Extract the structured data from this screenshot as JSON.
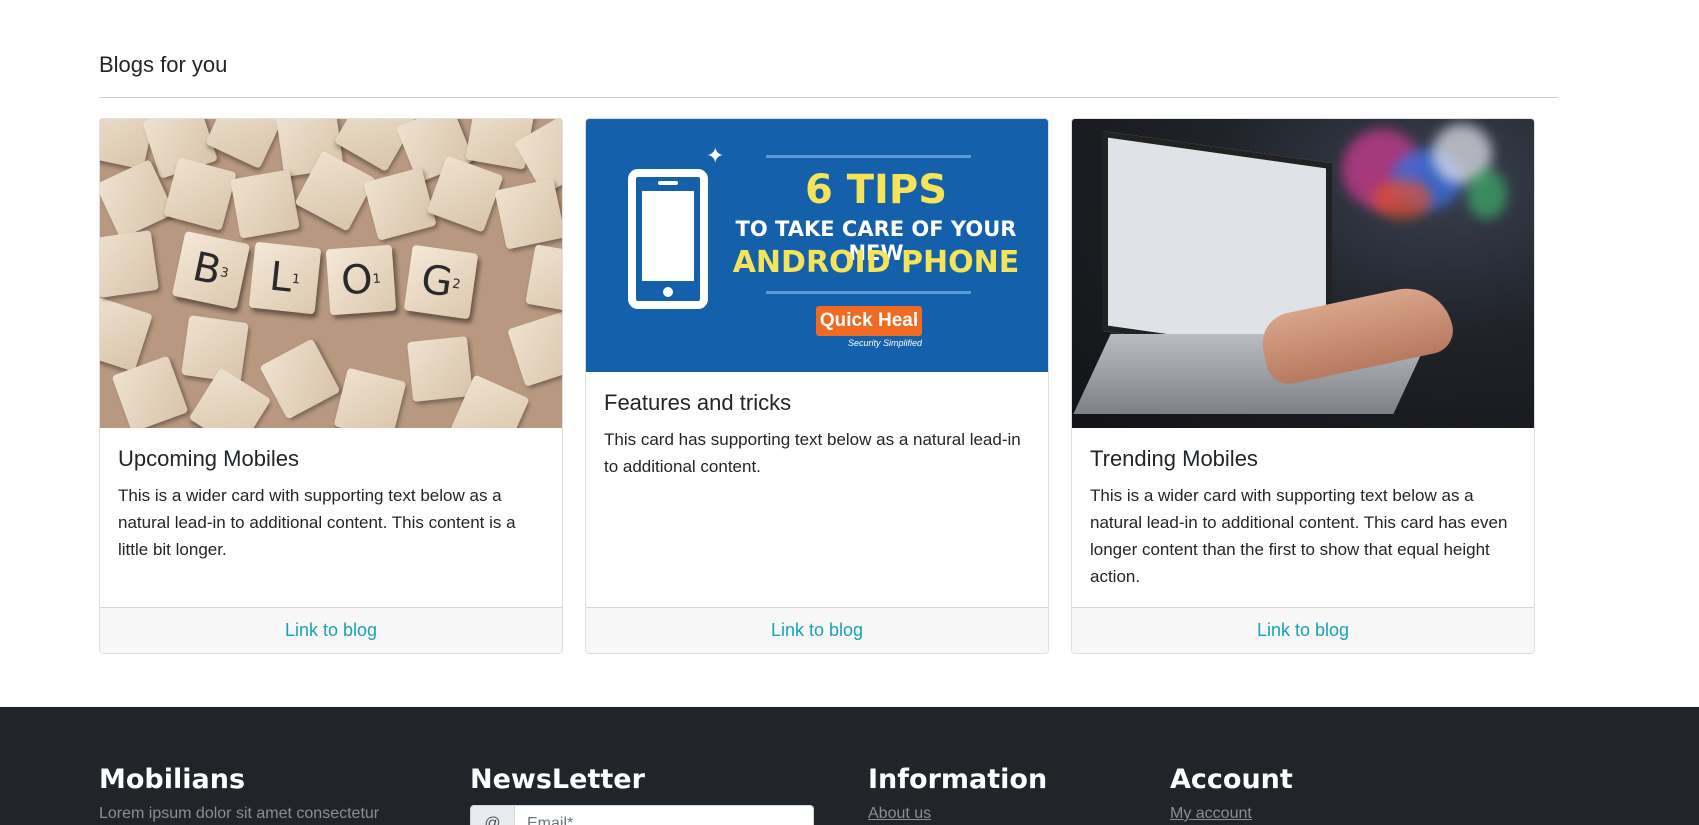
{
  "section": {
    "title": "Blogs for you"
  },
  "cards": [
    {
      "title": "Upcoming Mobiles",
      "text": "This is a wider card with supporting text below as a natural lead-in to additional content. This content is a little bit longer.",
      "link": "Link to blog",
      "image": {
        "tiles": [
          "B",
          "L",
          "O",
          "G"
        ],
        "subscripts": [
          "3",
          "1",
          "1",
          "2"
        ]
      }
    },
    {
      "title": "Features and tricks",
      "text": "This card has supporting text below as a natural lead-in to additional content.",
      "link": "Link to blog",
      "image": {
        "headline": "6 TIPS",
        "line1": "TO TAKE CARE OF YOUR NEW",
        "line2": "ANDROID PHONE",
        "brand": "Quick Heal",
        "tagline": "Security Simplified",
        "icon": "smartphone-icon"
      }
    },
    {
      "title": "Trending Mobiles",
      "text": "This is a wider card with supporting text below as a natural lead-in to additional content. This card has even longer content than the first to show that equal height action.",
      "link": "Link to blog"
    }
  ],
  "footer": {
    "brand": {
      "title": "Mobilians",
      "text": "Lorem ipsum dolor sit amet consectetur"
    },
    "newsletter": {
      "title": "NewsLetter",
      "prefix": "@",
      "placeholder": "Email*"
    },
    "information": {
      "title": "Information",
      "link": "About us"
    },
    "account": {
      "title": "Account",
      "link": "My account"
    },
    "colors": {
      "background": "#212529",
      "link": "#17a2b8"
    }
  }
}
